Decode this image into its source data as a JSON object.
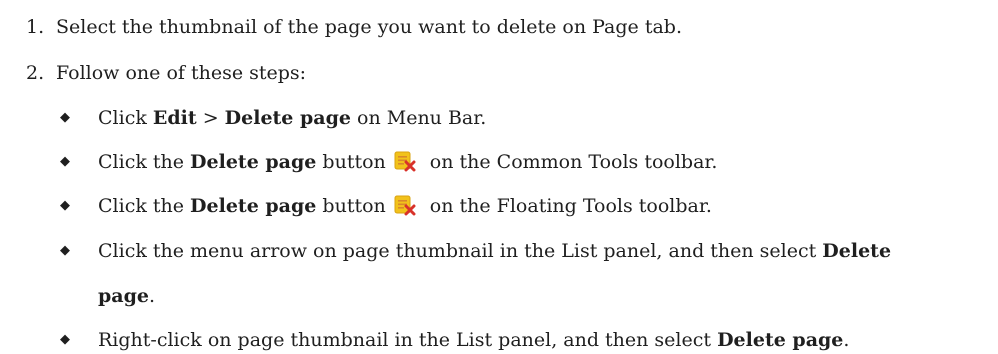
{
  "steps": [
    {
      "num": "1.",
      "text": "Select the thumbnail of the page you want to delete on Page tab."
    },
    {
      "num": "2.",
      "text": "Follow one of these steps:"
    }
  ],
  "options": [
    {
      "pre": "Click ",
      "bold1": "Edit",
      "mid": " > ",
      "bold2": "Delete page",
      "post": " on Menu Bar."
    },
    {
      "pre": "Click the ",
      "bold1": "Delete page",
      "mid": " button",
      "post": " on the Common Tools toolbar.",
      "icon": "delete-page-icon"
    },
    {
      "pre": "Click the ",
      "bold1": "Delete page",
      "mid": " button",
      "post": " on the Floating Tools toolbar.",
      "icon": "delete-page-icon"
    },
    {
      "pre": "Click the menu arrow on page thumbnail in the List panel, and then select ",
      "bold1": "Delete",
      "bold2": "page",
      "post": "."
    },
    {
      "pre": "Right-click on page thumbnail in the List panel, and then select ",
      "bold1": "Delete page",
      "post": "."
    }
  ],
  "bullet_char": "◆",
  "icon_colors": {
    "page": "#f2c21b",
    "lines": "#d9892a",
    "x": "#d8322a"
  }
}
